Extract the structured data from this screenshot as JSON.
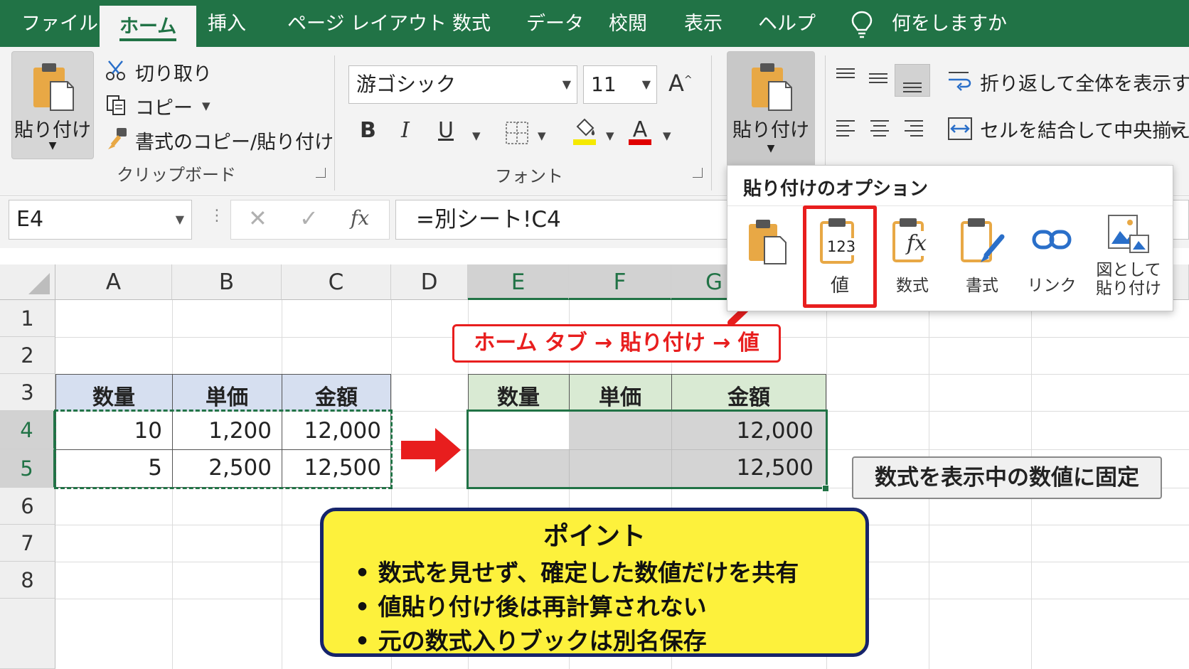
{
  "tabs": [
    {
      "label": "ファイル",
      "active": false
    },
    {
      "label": "ホーム",
      "active": true
    },
    {
      "label": "挿入",
      "active": false
    },
    {
      "label": "ページ レイアウト",
      "active": false
    },
    {
      "label": "数式",
      "active": false
    },
    {
      "label": "データ",
      "active": false
    },
    {
      "label": "校閲",
      "active": false
    },
    {
      "label": "表示",
      "active": false
    },
    {
      "label": "ヘルプ",
      "active": false
    },
    {
      "label": "何をしますか",
      "active": false
    }
  ],
  "clipboard": {
    "paste_label": "貼り付け",
    "cut_label": "切り取り",
    "copy_label": "コピー",
    "format_painter_label": "書式のコピー/貼り付け",
    "group_label": "クリップボード"
  },
  "font": {
    "font_name": "游ゴシック",
    "font_size": "11",
    "bold": "B",
    "italic": "I",
    "underline": "U",
    "group_label": "フォント",
    "highlight_color": "#f5e900",
    "font_color": "#e00000"
  },
  "paste_group": {
    "paste_label": "貼り付け"
  },
  "alignment": {
    "wrap_text_label": "折り返して全体を表示する",
    "merge_center_label": "セルを結合して中央揃え"
  },
  "formula_bar": {
    "name_box": "E4",
    "cancel": "✕",
    "enter": "✓",
    "fx": "fx",
    "formula": "=別シート!C4"
  },
  "columns": [
    "A",
    "B",
    "C",
    "D",
    "E",
    "F",
    "G"
  ],
  "rows": [
    "1",
    "2",
    "3",
    "4",
    "5",
    "6",
    "7",
    "8"
  ],
  "source_table": {
    "headers": [
      "数量",
      "単価",
      "金額"
    ],
    "rows": [
      [
        "10",
        "1,200",
        "12,000"
      ],
      [
        "5",
        "2,500",
        "12,500"
      ]
    ]
  },
  "dest_table": {
    "headers": [
      "数量",
      "単価",
      "金額"
    ],
    "rows": [
      [
        "",
        "",
        "12,000"
      ],
      [
        "",
        "",
        "12,500"
      ]
    ]
  },
  "paste_options": {
    "title": "貼り付けのオプション",
    "items": [
      {
        "label": "",
        "icon": "paste-clipboard-icon"
      },
      {
        "label": "値",
        "badge": "123",
        "icon": "paste-values-icon",
        "highlighted": true
      },
      {
        "label": "数式",
        "badge": "fx",
        "icon": "paste-formulas-icon"
      },
      {
        "label": "書式",
        "icon": "paste-formatting-icon"
      },
      {
        "label": "リンク",
        "icon": "paste-link-icon"
      },
      {
        "label_line1": "図として",
        "label_line2": "貼り付け",
        "icon": "paste-picture-icon"
      }
    ]
  },
  "annotations": {
    "callout": "ホーム タブ → 貼り付け → 値",
    "note": "数式を表示中の数値に固定",
    "point_title": "ポイント",
    "points": [
      "• 数式を見せず、確定した数値だけを共有",
      "• 値貼り付け後は再計算されない",
      "• 元の数式入りブックは別名保存"
    ]
  },
  "colors": {
    "excel_green": "#217346",
    "accent_red": "#e81e1e",
    "source_header_fill": "#d6dff0",
    "dest_header_fill": "#d9ead3",
    "point_fill": "#fdf13c",
    "point_border": "#16246b"
  }
}
